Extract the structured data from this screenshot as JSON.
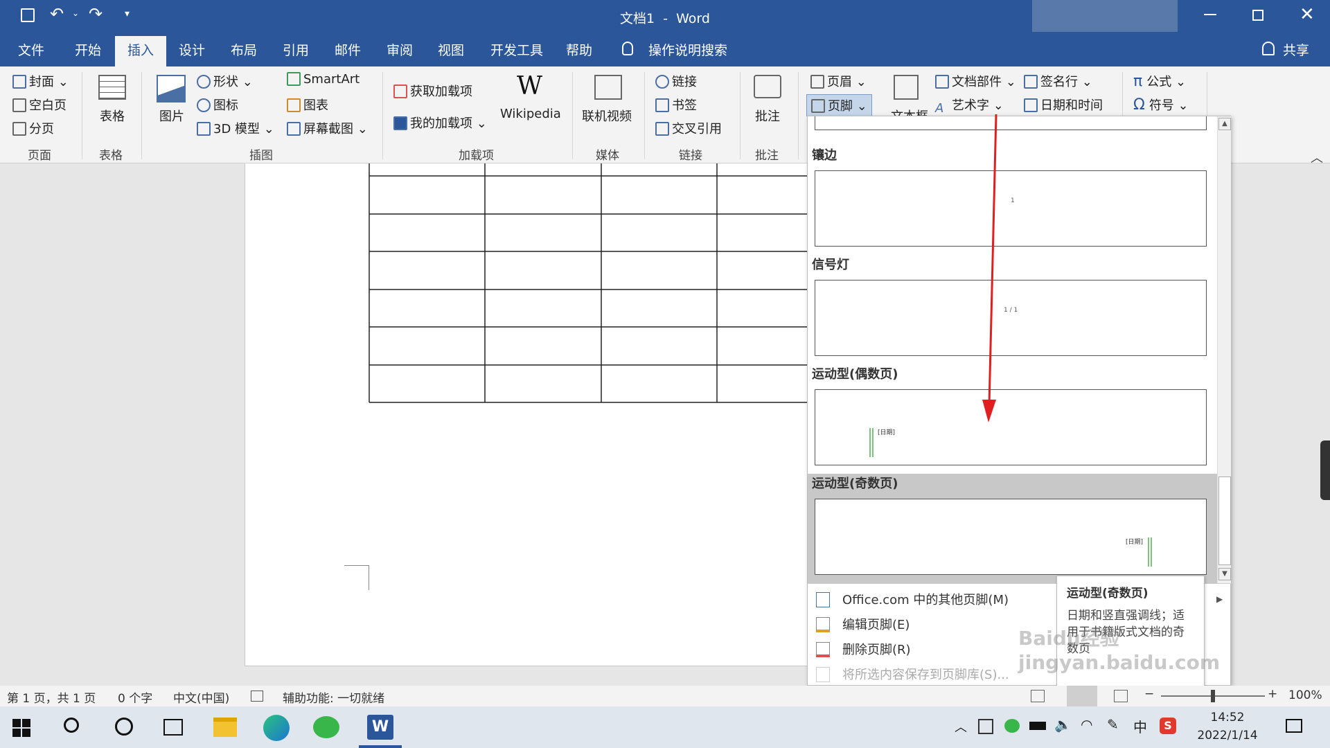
{
  "window": {
    "title": "文档1  -  Word",
    "accent": "#2b579a"
  },
  "tabs": [
    "文件",
    "开始",
    "插入",
    "设计",
    "布局",
    "引用",
    "邮件",
    "审阅",
    "视图",
    "开发工具",
    "帮助"
  ],
  "active_tab": "插入",
  "search": {
    "label": "操作说明搜索"
  },
  "share": {
    "label": "共享"
  },
  "ribbon": {
    "pages": {
      "cover": "封面",
      "blank": "空白页",
      "break": "分页",
      "group": "页面"
    },
    "table": {
      "label": "表格",
      "group": "表格"
    },
    "illustrations": {
      "picture": "图片",
      "shapes": "形状",
      "icons": "图标",
      "model3d": "3D 模型",
      "smartart": "SmartArt",
      "chart": "图表",
      "screenshot": "屏幕截图",
      "group": "插图"
    },
    "addins": {
      "get": "获取加载项",
      "mine": "我的加载项",
      "wikipedia": "Wikipedia",
      "group": "加载项"
    },
    "media": {
      "video": "联机视频",
      "group": "媒体"
    },
    "links": {
      "link": "链接",
      "bookmark": "书签",
      "crossref": "交叉引用",
      "group": "链接"
    },
    "comments": {
      "comment": "批注",
      "group": "批注"
    },
    "headerfooter": {
      "header": "页眉",
      "footer": "页脚"
    },
    "text": {
      "textbox": "文本框",
      "quickparts": "文档部件",
      "wordart": "艺术字",
      "signature": "签名行",
      "datetime": "日期和时间"
    },
    "symbols": {
      "equation": "公式",
      "symbol": "符号"
    }
  },
  "gallery": {
    "items": [
      {
        "title": "镶边",
        "sample": "1"
      },
      {
        "title": "信号灯",
        "sample": "1 / 1"
      },
      {
        "title": "运动型(偶数页)",
        "sample": "[日期]"
      },
      {
        "title": "运动型(奇数页)",
        "sample": "[日期]"
      }
    ],
    "menu": [
      {
        "label": "Office.com 中的其他页脚(M)",
        "enabled": true
      },
      {
        "label": "编辑页脚(E)",
        "enabled": true
      },
      {
        "label": "删除页脚(R)",
        "enabled": true
      },
      {
        "label": "将所选内容保存到页脚库(S)...",
        "enabled": false
      }
    ]
  },
  "tooltip": {
    "title": "运动型(奇数页)",
    "body": "日期和竖直强调线；适用于书籍版式文档的奇数页"
  },
  "status": {
    "page": "第 1 页，共 1 页",
    "words": "0 个字",
    "lang": "中文(中国)",
    "access": "辅助功能: 一切就绪",
    "zoom": "100%"
  },
  "taskbar": {
    "time": "14:52",
    "date": "2022/1/14",
    "ime": "中"
  },
  "watermark": "Baidu经验 jingyan.baidu.com",
  "table_grid": {
    "rows": 7,
    "cols": 4
  }
}
